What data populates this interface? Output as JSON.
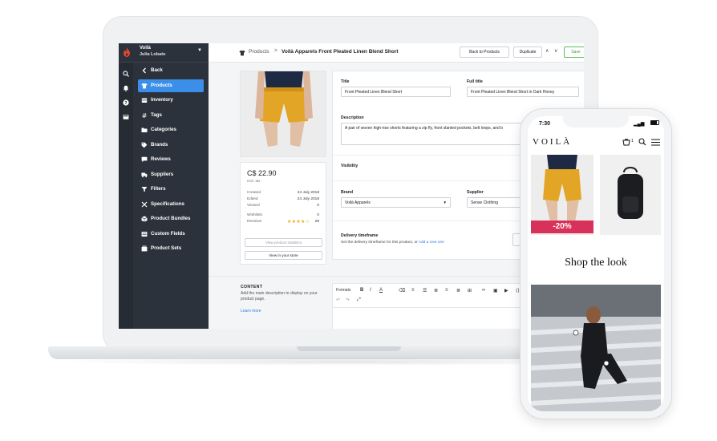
{
  "admin": {
    "store": {
      "name": "Voilà",
      "user": "Julia Lobato"
    },
    "nav": [
      {
        "label": "Back",
        "icon": "chevron-left-icon"
      },
      {
        "label": "Products",
        "icon": "shirt-icon",
        "active": true
      },
      {
        "label": "Inventory",
        "icon": "inventory-icon"
      },
      {
        "label": "Tags",
        "icon": "hash-icon"
      },
      {
        "label": "Categories",
        "icon": "folder-icon"
      },
      {
        "label": "Brands",
        "icon": "tag-icon"
      },
      {
        "label": "Reviews",
        "icon": "chat-icon"
      },
      {
        "label": "Suppliers",
        "icon": "truck-icon"
      },
      {
        "label": "Filters",
        "icon": "filter-icon"
      },
      {
        "label": "Specifications",
        "icon": "wrench-icon"
      },
      {
        "label": "Product Bundles",
        "icon": "box-icon"
      },
      {
        "label": "Custom Fields",
        "icon": "list-icon"
      },
      {
        "label": "Product Sets",
        "icon": "stack-icon"
      }
    ],
    "breadcrumb": {
      "parent": "Products",
      "separator": ">",
      "current": "Voilà Apparels Front Pleated Linen Blend Short"
    },
    "toolbar": {
      "back": "Back to Products",
      "duplicate": "Duplicate",
      "prev": "∧",
      "next": "∨",
      "save": "Save"
    },
    "product": {
      "price": "C$ 22.90",
      "price_note": "excl. tax",
      "meta": [
        {
          "label": "Created",
          "value": "24 July 2018"
        },
        {
          "label": "Edited",
          "value": "24 July 2018"
        },
        {
          "label": "Viewed",
          "value": "0"
        }
      ],
      "wishlists": {
        "label": "Wishlists",
        "value": "0"
      },
      "reviews": {
        "label": "Reviews",
        "stars": "★★★★☆",
        "value": "28"
      },
      "stats_button": "View product statistics",
      "store_button": "View in your store"
    },
    "form": {
      "title_label": "Title",
      "title_value": "Front Pleated Linen Blend Short",
      "full_title_label": "Full title",
      "full_title_value": "Front Pleated Linen Blend Short in Dark Honey",
      "description_label": "Description",
      "description_value": "A pair of woven high-rise shorts featuring a zip fly, front slanted pockets, belt loops, and b",
      "visibility_label": "Visibility",
      "brand_label": "Brand",
      "brand_value": "Voilà Apparels",
      "supplier_label": "Supplier",
      "supplier_value": "Sense Clothing",
      "delivery_label": "Delivery timeframe",
      "delivery_help": "Set the delivery timeframe for this product, or",
      "delivery_link": "Add a new one"
    },
    "content": {
      "heading": "CONTENT",
      "help": "Add the main description to display on your product page.",
      "link": "Learn more",
      "formats": "Formats"
    }
  },
  "phone": {
    "time": "7:30",
    "brand": "VOILÀ",
    "cart_count": "1",
    "discount": "-20%",
    "section_title": "Shop the look"
  },
  "colors": {
    "sidebar": "#2b323b",
    "active": "#3b8fe8",
    "shorts": "#e3a526",
    "discount": "#d9325a",
    "save": "#3a9d3a"
  }
}
